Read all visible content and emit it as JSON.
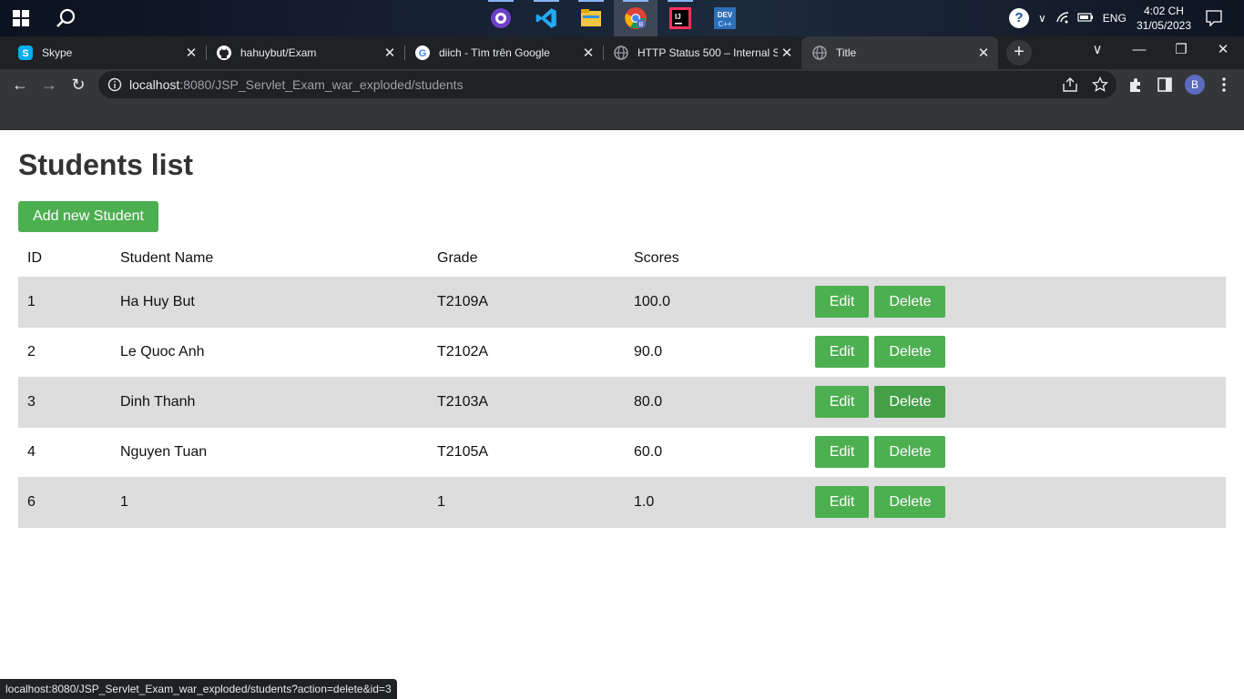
{
  "taskbar": {
    "apps": [
      {
        "name": "github-desktop-icon"
      },
      {
        "name": "vscode-icon"
      },
      {
        "name": "file-explorer-icon"
      },
      {
        "name": "chrome-icon"
      },
      {
        "name": "intellij-icon"
      },
      {
        "name": "devc-icon"
      }
    ],
    "language": "ENG",
    "time": "4:02 CH",
    "date": "31/05/2023"
  },
  "browser": {
    "tabs": [
      {
        "title": "Skype",
        "icon": "skype-icon"
      },
      {
        "title": "hahuybut/Exam",
        "icon": "github-icon"
      },
      {
        "title": "diich - Tìm trên Google",
        "icon": "google-icon"
      },
      {
        "title": "HTTP Status 500 – Internal Se",
        "icon": "globe-icon"
      },
      {
        "title": "Title",
        "icon": "globe-icon",
        "active": true
      }
    ],
    "url_host": "localhost",
    "url_rest": ":8080/JSP_Servlet_Exam_war_exploded/students",
    "profile_initial": "B"
  },
  "page": {
    "title": "Students list",
    "add_button": "Add new Student",
    "columns": [
      "ID",
      "Student Name",
      "Grade",
      "Scores"
    ],
    "rows": [
      {
        "id": "1",
        "name": "Ha Huy But",
        "grade": "T2109A",
        "score": "100.0"
      },
      {
        "id": "2",
        "name": "Le Quoc Anh",
        "grade": "T2102A",
        "score": "90.0"
      },
      {
        "id": "3",
        "name": "Dinh Thanh",
        "grade": "T2103A",
        "score": "80.0"
      },
      {
        "id": "4",
        "name": "Nguyen Tuan",
        "grade": "T2105A",
        "score": "60.0"
      },
      {
        "id": "6",
        "name": "1",
        "grade": "1",
        "score": "1.0"
      }
    ],
    "edit_label": "Edit",
    "delete_label": "Delete"
  },
  "status_bar": "localhost:8080/JSP_Servlet_Exam_war_exploded/students?action=delete&id=3",
  "colors": {
    "button_green": "#4caf50",
    "row_stripe": "#dddddd",
    "title_text": "#333333"
  }
}
